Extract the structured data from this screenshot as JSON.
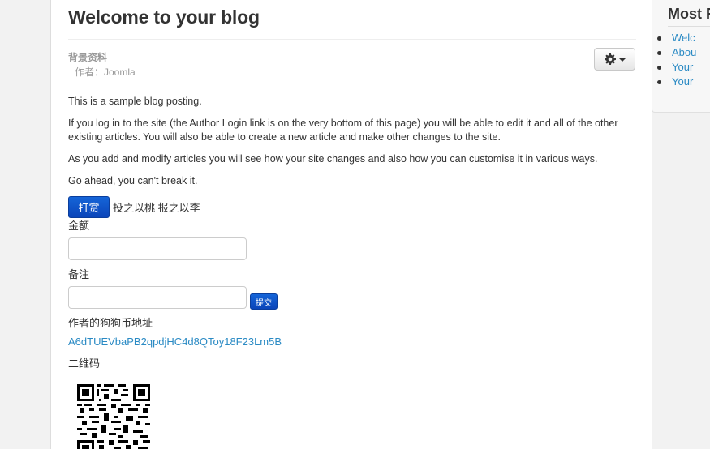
{
  "article": {
    "title": "Welcome to your blog",
    "category": "背景资料",
    "author": "作者：Joomla",
    "paragraphs": [
      "This is a sample blog posting.",
      "If you log in to the site (the Author Login link is on the very bottom of this page) you will be able to edit it and all of the other existing articles. You will also be able to create a new article and make other changes to the site.",
      "As you add and modify articles you will see how your site changes and also how you can customise it in various ways.",
      "Go ahead, you can't break it."
    ]
  },
  "tools": {
    "icon": "gear-icon",
    "dropdown_icon": "caret-down-icon"
  },
  "reward": {
    "button_label": "打赏",
    "slogan": "投之以桃 报之以李",
    "amount_label": "金额",
    "amount_value": "",
    "note_label": "备注",
    "note_value": "",
    "submit_label": "提交",
    "address_label": "作者的狗狗币地址",
    "address": "A6dTUEVbaPB2qpdjHC4d8QToy18F23Lm5B",
    "qr_label": "二维码"
  },
  "sidebar": {
    "title": "Most R",
    "items": [
      {
        "label": "Welc"
      },
      {
        "label": "Abou"
      },
      {
        "label": "Your"
      },
      {
        "label": "Your"
      }
    ]
  },
  "colors": {
    "link": "#2a8ac4",
    "button": "#0b45b9",
    "text": "#333333",
    "muted": "#999999"
  }
}
